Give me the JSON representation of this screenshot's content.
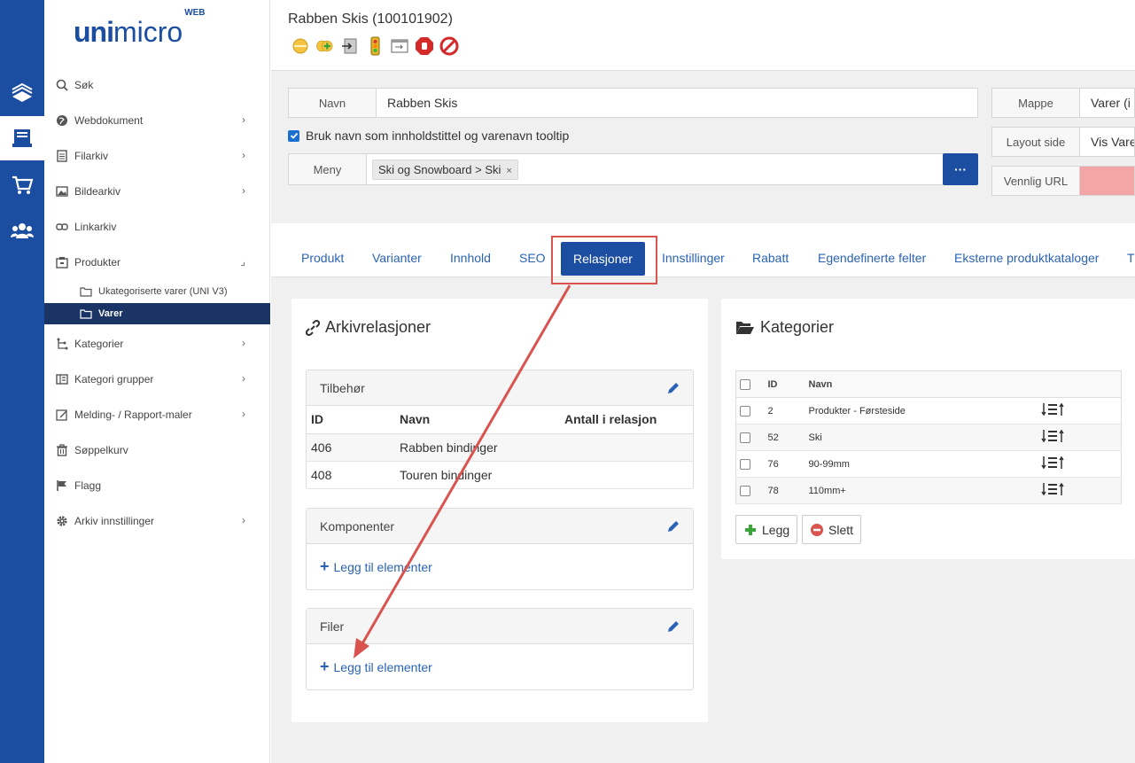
{
  "logo": {
    "bold": "uni",
    "light": "micro",
    "sup": "WEB"
  },
  "sidebar": {
    "items": [
      {
        "label": "Søk"
      },
      {
        "label": "Webdokument"
      },
      {
        "label": "Filarkiv"
      },
      {
        "label": "Bildearkiv"
      },
      {
        "label": "Linkarkiv"
      },
      {
        "label": "Produkter"
      },
      {
        "label": "Kategorier"
      },
      {
        "label": "Kategori grupper"
      },
      {
        "label": "Melding- / Rapport-maler"
      },
      {
        "label": "Søppelkurv"
      },
      {
        "label": "Flagg"
      },
      {
        "label": "Arkiv innstillinger"
      }
    ],
    "sub_items": [
      {
        "label": "Ukategoriserte varer (UNI V3)"
      },
      {
        "label": "Varer"
      }
    ]
  },
  "header": {
    "title": "Rabben Skis (100101902)"
  },
  "form": {
    "navn_label": "Navn",
    "navn_value": "Rabben Skis",
    "checkbox_label": "Bruk navn som innholdstittel og varenavn tooltip",
    "meny_label": "Meny",
    "meny_tag": "Ski og Snowboard > Ski",
    "meny_tag_remove": "×",
    "more_label": "···",
    "mappe_label": "Mappe",
    "mappe_value": "Varer (i",
    "layout_label": "Layout side",
    "layout_value": "Vis Vare",
    "url_label": "Vennlig URL"
  },
  "tabs": [
    "Produkt",
    "Varianter",
    "Innhold",
    "SEO",
    "Relasjoner",
    "Innstillinger",
    "Rabatt",
    "Egendefinerte felter",
    "Eksterne produktkataloger",
    "T"
  ],
  "arkiv": {
    "title": "Arkivrelasjoner",
    "tilbehor": {
      "title": "Tilbehør",
      "columns": [
        "ID",
        "Navn",
        "Antall i relasjon"
      ],
      "rows": [
        {
          "id": "406",
          "navn": "Rabben bindinger",
          "antall": ""
        },
        {
          "id": "408",
          "navn": "Touren bindinger",
          "antall": ""
        }
      ]
    },
    "komponenter": {
      "title": "Komponenter",
      "add": "Legg til elementer"
    },
    "filer": {
      "title": "Filer",
      "add": "Legg til elementer"
    }
  },
  "kategorier": {
    "title": "Kategorier",
    "columns": [
      "ID",
      "Navn"
    ],
    "rows": [
      {
        "id": "2",
        "navn": "Produkter - Førsteside"
      },
      {
        "id": "52",
        "navn": "Ski"
      },
      {
        "id": "76",
        "navn": "90-99mm"
      },
      {
        "id": "78",
        "navn": "110mm+"
      }
    ],
    "add_button": "Legg",
    "delete_button": "Slett"
  },
  "colors": {
    "primary": "#1b4da0",
    "highlight": "#d9534f",
    "link": "#2a63b5"
  }
}
